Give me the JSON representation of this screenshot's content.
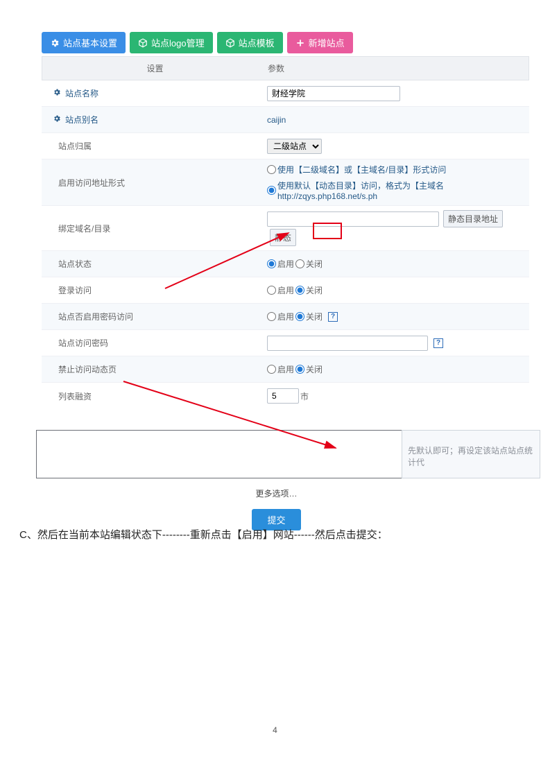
{
  "tabs": {
    "basic": "站点基本设置",
    "logo": "站点logo管理",
    "template": "站点模板",
    "add": "新增站点"
  },
  "header": {
    "col1": "设置",
    "col2": "参数"
  },
  "labels": {
    "site_name": "站点名称",
    "site_alias": "站点别名",
    "site_belong": "站点归属",
    "addr_form": "启用访问地址形式",
    "bind_domain": "绑定域名/目录",
    "site_status": "站点状态",
    "login_visit": "登录访问",
    "pwd_visit": "站点否启用密码访问",
    "visit_pwd": "站点访问密码",
    "no_dynamic": "禁止访问动态页",
    "list_fee": "列表融资"
  },
  "values": {
    "site_name": "财经学院",
    "site_alias": "caijin",
    "select_belong": "二级站点",
    "addr_opt1_a": "使用【二级域名】或【主域名/目录】形式访问",
    "addr_opt2_a": "使用默认【动态目录】访问，格式为【主域名 http://zqys.php168.net/s.ph",
    "btn_static1": "静态目录地址",
    "btn_static2": "静态",
    "enable": "启用",
    "close": "关闭",
    "num": "5",
    "num_suffix": "市",
    "side_note": "先默认即可；再设定该站点站点统计代",
    "more": "更多选项…",
    "submit": "提交"
  },
  "instruction": "C、然后在当前本站编辑状态下--------重新点击【启用】网站------然后点击提交：",
  "page_number": "4"
}
